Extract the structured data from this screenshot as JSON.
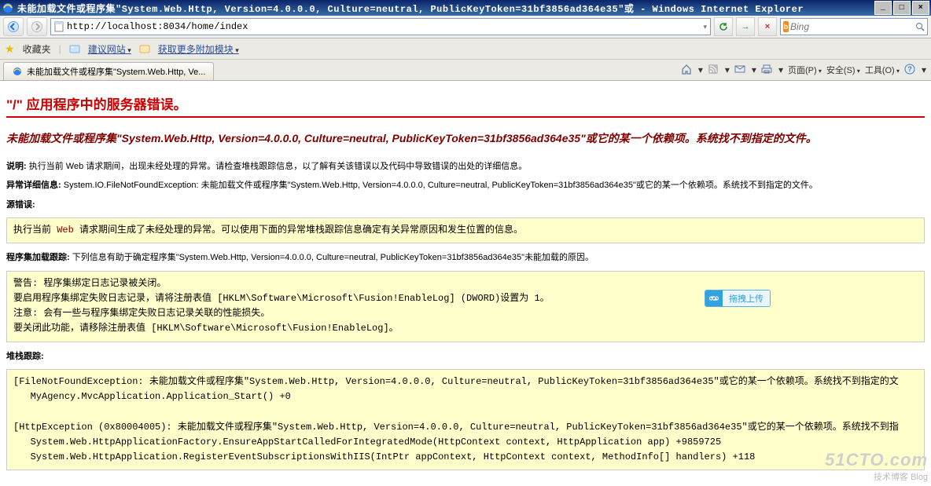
{
  "window": {
    "title": "未能加载文件或程序集\"System.Web.Http, Version=4.0.0.0, Culture=neutral, PublicKeyToken=31bf3856ad364e35\"或 - Windows Internet Explorer"
  },
  "address": {
    "url": "http://localhost:8034/home/index"
  },
  "search": {
    "provider": "Bing"
  },
  "favbar": {
    "fav_label": "收藏夹",
    "suggest_label": "建议网站",
    "addons_label": "获取更多附加模块"
  },
  "tab": {
    "label": "未能加载文件或程序集\"System.Web.Http, Ve..."
  },
  "cmdbar": {
    "page": "页面(P)",
    "safety": "安全(S)",
    "tools": "工具(O)"
  },
  "error": {
    "h1": "\"/\" 应用程序中的服务器错误。",
    "h2": "未能加载文件或程序集\"System.Web.Http, Version=4.0.0.0, Culture=neutral, PublicKeyToken=31bf3856ad364e35\"或它的某一个依赖项。系统找不到指定的文件。",
    "desc_label": "说明:",
    "desc_text": "执行当前 Web 请求期间，出现未经处理的异常。请检查堆栈跟踪信息，以了解有关该错误以及代码中导致错误的出处的详细信息。",
    "exc_label": "异常详细信息:",
    "exc_text": "System.IO.FileNotFoundException: 未能加载文件或程序集\"System.Web.Http, Version=4.0.0.0, Culture=neutral, PublicKeyToken=31bf3856ad364e35\"或它的某一个依赖项。系统找不到指定的文件。",
    "src_label": "源错误:",
    "src_box_pre": "执行当前 ",
    "src_box_web": "Web",
    "src_box_post": " 请求期间生成了未经处理的异常。可以使用下面的异常堆栈跟踪信息确定有关异常原因和发生位置的信息。",
    "load_label": "程序集加载跟踪:",
    "load_text": "下列信息有助于确定程序集\"System.Web.Http, Version=4.0.0.0, Culture=neutral, PublicKeyToken=31bf3856ad364e35\"未能加载的原因。",
    "load_box": "警告: 程序集绑定日志记录被关闭。\n要启用程序集绑定失败日志记录，请将注册表值 [HKLM\\Software\\Microsoft\\Fusion!EnableLog] (DWORD)设置为 1。\n注意: 会有一些与程序集绑定失败日志记录关联的性能损失。\n要关闭此功能，请移除注册表值 [HKLM\\Software\\Microsoft\\Fusion!EnableLog]。",
    "stack_label": "堆栈跟踪:",
    "stack_box": "[FileNotFoundException: 未能加载文件或程序集\"System.Web.Http, Version=4.0.0.0, Culture=neutral, PublicKeyToken=31bf3856ad364e35\"或它的某一个依赖项。系统找不到指定的文\n   MyAgency.MvcApplication.Application_Start() +0\n\n[HttpException (0x80004005): 未能加载文件或程序集\"System.Web.Http, Version=4.0.0.0, Culture=neutral, PublicKeyToken=31bf3856ad364e35\"或它的某一个依赖项。系统找不到指\n   System.Web.HttpApplicationFactory.EnsureAppStartCalledForIntegratedMode(HttpContext context, HttpApplication app) +9859725\n   System.Web.HttpApplication.RegisterEventSubscriptionsWithIIS(IntPtr appContext, HttpContext context, MethodInfo[] handlers) +118"
  },
  "floatbtn": {
    "label": "拖拽上传"
  },
  "watermark": {
    "big": "51CTO.com",
    "small": "技术博客    Blog"
  }
}
